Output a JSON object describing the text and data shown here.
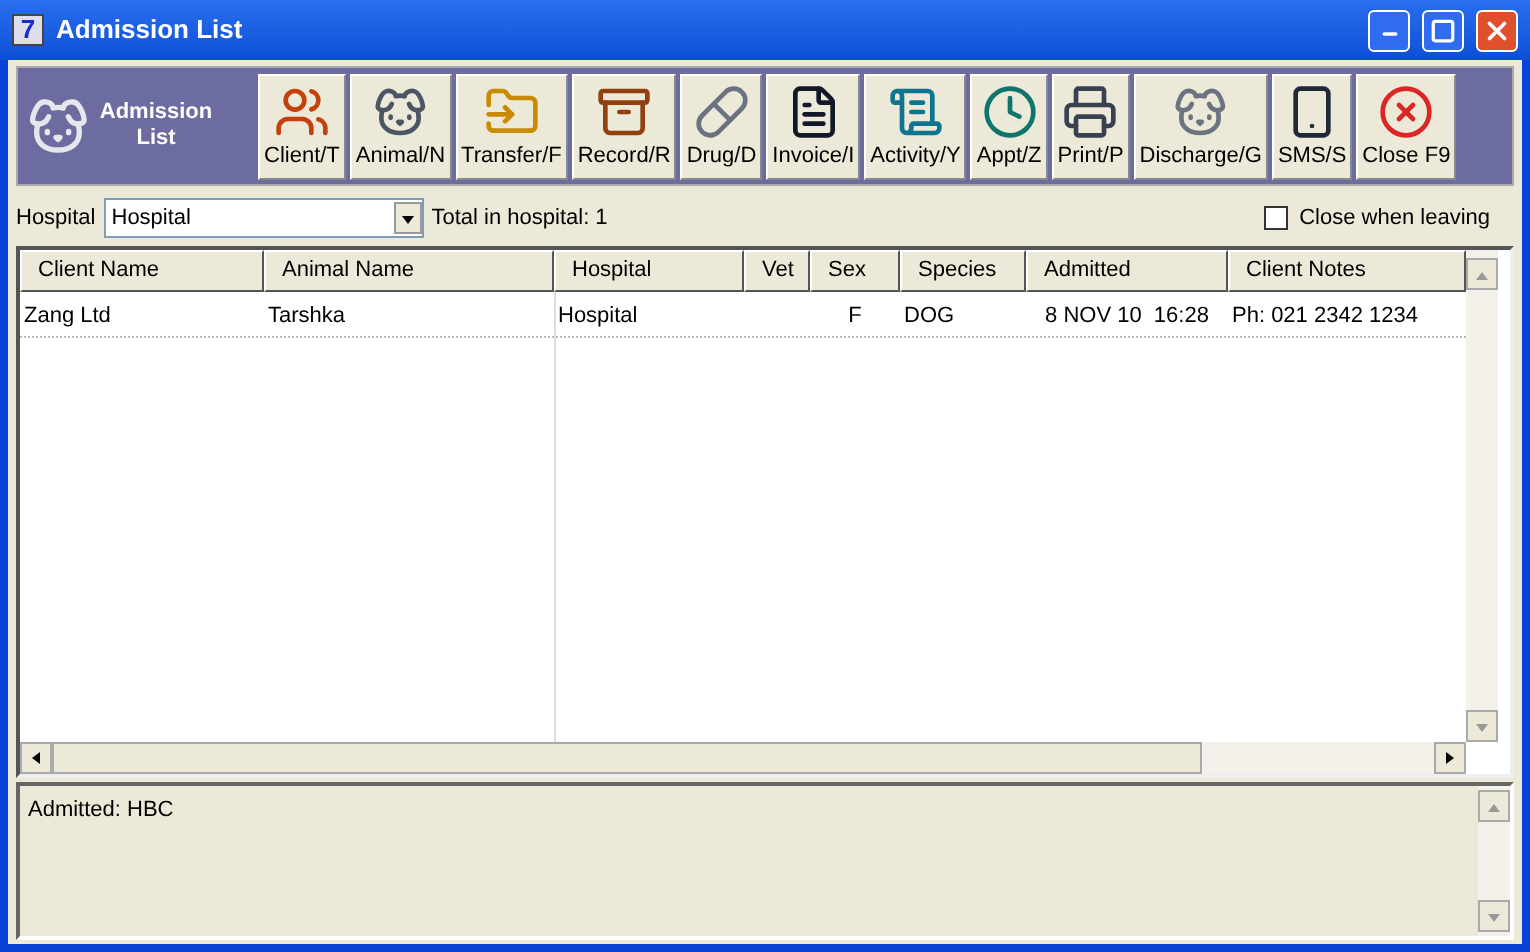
{
  "window": {
    "title": "Admission List",
    "icon_label": "7"
  },
  "toolbar": {
    "title": "Admission List",
    "buttons": [
      {
        "label": "Client/T"
      },
      {
        "label": "Animal/N"
      },
      {
        "label": "Transfer/F"
      },
      {
        "label": "Record/R"
      },
      {
        "label": "Drug/D"
      },
      {
        "label": "Invoice/I"
      },
      {
        "label": "Activity/Y"
      },
      {
        "label": "Appt/Z"
      },
      {
        "label": "Print/P"
      },
      {
        "label": "Discharge/G"
      },
      {
        "label": "SMS/S"
      },
      {
        "label": "Close F9"
      }
    ]
  },
  "filter": {
    "label": "Hospital",
    "value": "Hospital",
    "total": "Total in hospital: 1",
    "close_when_leaving": {
      "label": "Close when leaving",
      "checked": false
    }
  },
  "table": {
    "columns": [
      "Client Name",
      "Animal Name",
      "Hospital",
      "Vet",
      "Sex",
      "Species",
      "Admitted",
      "Client Notes"
    ],
    "rows": [
      {
        "selected": false,
        "cells": [
          "Zang Ltd",
          "Tarshka",
          "Hospital",
          "",
          "F",
          "DOG",
          "8 NOV 10  16:28",
          "Ph: 021 2342 1234"
        ]
      }
    ]
  },
  "notes": {
    "text": "Admitted: HBC"
  }
}
